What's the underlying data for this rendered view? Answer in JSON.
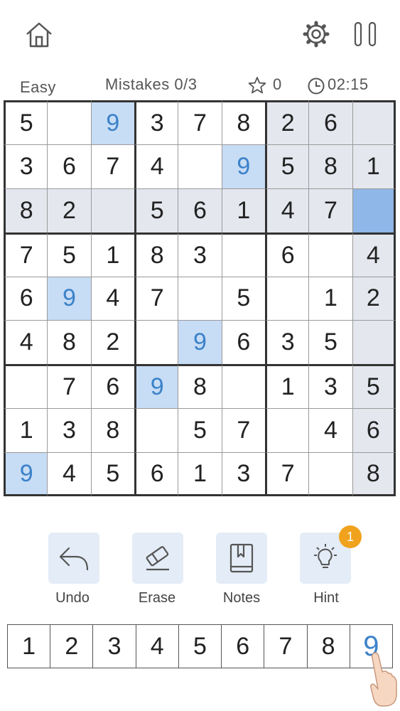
{
  "header": {
    "difficulty": "Easy",
    "mistakes": "Mistakes 0/3",
    "stars": "0",
    "timer": "02:15"
  },
  "grid": [
    [
      "5",
      "",
      "9",
      "3",
      "7",
      "8",
      "2",
      "6",
      ""
    ],
    [
      "3",
      "6",
      "7",
      "4",
      "",
      "9",
      "5",
      "8",
      "1"
    ],
    [
      "8",
      "2",
      "",
      "5",
      "6",
      "1",
      "4",
      "7",
      ""
    ],
    [
      "7",
      "5",
      "1",
      "8",
      "3",
      "",
      "6",
      "",
      "4"
    ],
    [
      "6",
      "9",
      "4",
      "7",
      "",
      "5",
      "",
      "1",
      "2"
    ],
    [
      "4",
      "8",
      "2",
      "",
      "9",
      "6",
      "3",
      "5",
      ""
    ],
    [
      "",
      "7",
      "6",
      "9",
      "8",
      "",
      "1",
      "3",
      "5"
    ],
    [
      "1",
      "3",
      "8",
      "",
      "5",
      "7",
      "",
      "4",
      "6"
    ],
    [
      "9",
      "4",
      "5",
      "6",
      "1",
      "3",
      "7",
      "",
      "8"
    ]
  ],
  "selected_cell": {
    "row": 2,
    "col": 8
  },
  "highlighted_number": "9",
  "colors": {
    "selected": "#8fb7e8",
    "same_number": "#c7dcf5",
    "related": "#e4e7ee",
    "highlight_text": "#3b82c9",
    "tool_bg": "#e4ecf7",
    "hint_badge": "#f0a21d"
  },
  "tools": {
    "undo": "Undo",
    "erase": "Erase",
    "notes": "Notes",
    "hint": "Hint",
    "hint_count": "1"
  },
  "numpad": [
    "1",
    "2",
    "3",
    "4",
    "5",
    "6",
    "7",
    "8",
    "9"
  ],
  "icons": {
    "home": "home-icon",
    "settings": "gear-icon",
    "pause": "pause-icon",
    "star": "star-icon",
    "clock": "clock-icon",
    "undo": "undo-icon",
    "erase": "eraser-icon",
    "notes": "notebook-icon",
    "hint": "lightbulb-icon",
    "pointer": "hand-pointer-icon"
  }
}
